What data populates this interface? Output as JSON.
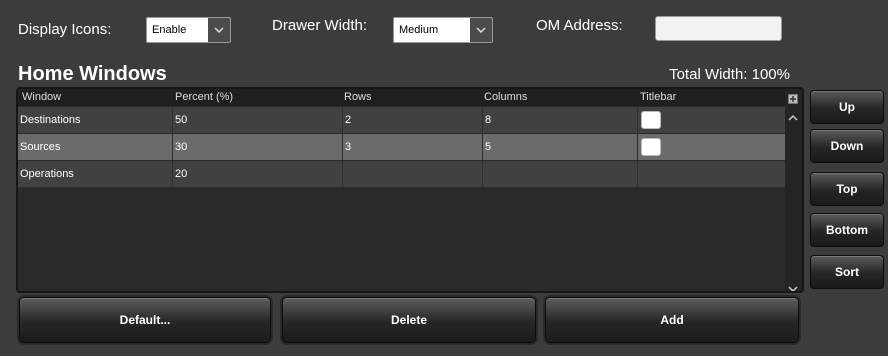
{
  "settings": {
    "display_icons_label": "Display Icons:",
    "display_icons_value": "Enable",
    "drawer_width_label": "Drawer Width:",
    "drawer_width_value": "Medium",
    "om_address_label": "OM Address:",
    "om_address_value": ""
  },
  "section": {
    "title": "Home Windows",
    "total_width": "Total Width: 100%"
  },
  "table": {
    "columns": [
      "Window",
      "Percent (%)",
      "Rows",
      "Columns",
      "Titlebar"
    ],
    "rows": [
      {
        "window": "Destinations",
        "percent": "50",
        "rows": "2",
        "columns": "8",
        "titlebar": false,
        "selected": false
      },
      {
        "window": "Sources",
        "percent": "30",
        "rows": "3",
        "columns": "5",
        "titlebar": false,
        "selected": true
      },
      {
        "window": "Operations",
        "percent": "20",
        "rows": "",
        "columns": "",
        "titlebar": null,
        "selected": false
      }
    ]
  },
  "side_buttons": {
    "up": "Up",
    "down": "Down",
    "top": "Top",
    "bottom": "Bottom",
    "sort": "Sort"
  },
  "bottom_buttons": {
    "default": "Default...",
    "delete": "Delete",
    "add": "Add"
  },
  "colors": {
    "background": "#3c3c3c",
    "row_normal": "#414141",
    "row_selected": "#6b6b6b",
    "grid_bg": "#2a2a2a"
  }
}
